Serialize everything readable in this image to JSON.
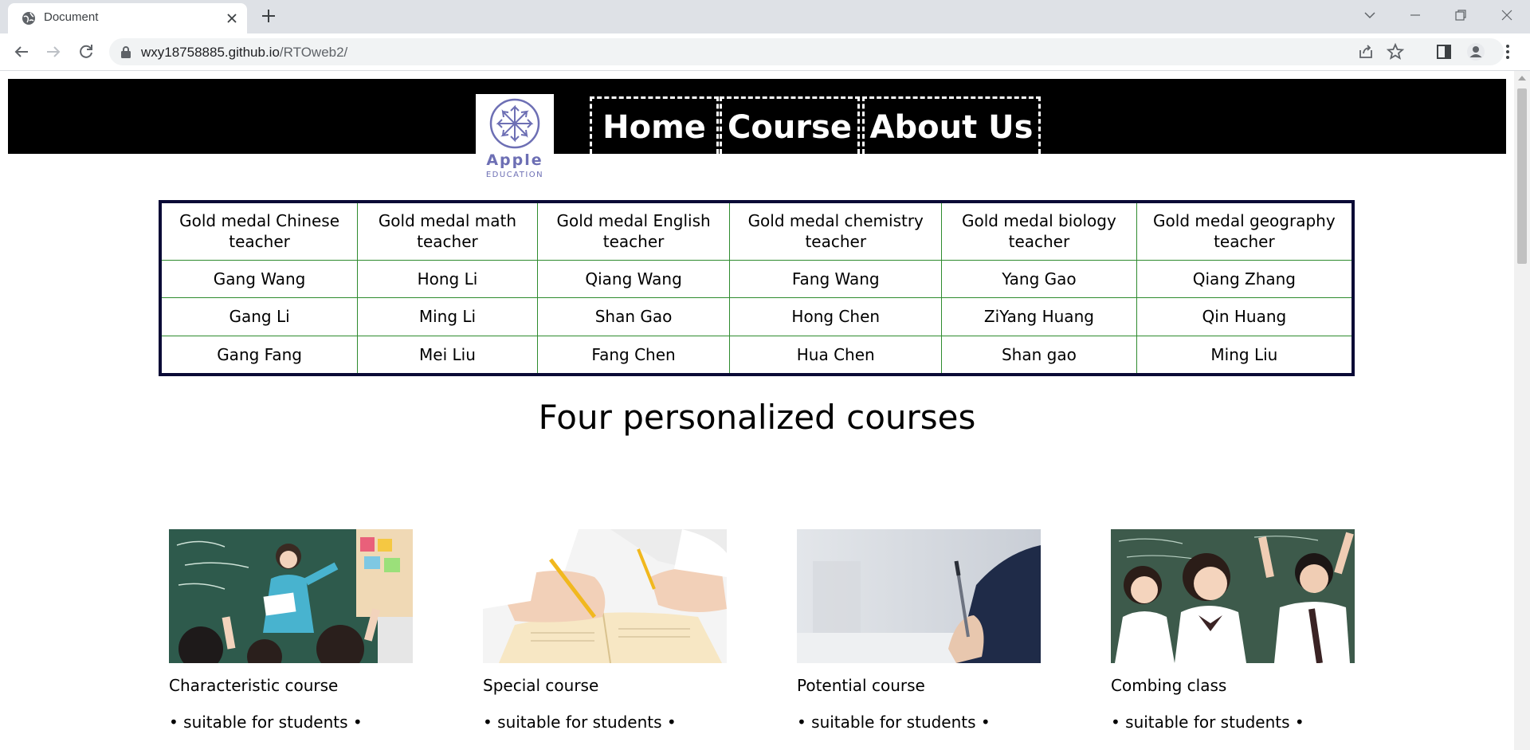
{
  "browser": {
    "tab_title": "Document",
    "url_host": "wxy18758885.github.io",
    "url_path": "/RTOweb2/"
  },
  "site": {
    "logo": {
      "brand": "Apple",
      "sub": "EDUCATION"
    },
    "nav": [
      {
        "label": "Home"
      },
      {
        "label": "Course"
      },
      {
        "label": "About Us"
      }
    ]
  },
  "teachers": {
    "headers": [
      "Gold medal Chinese teacher",
      "Gold medal math teacher",
      "Gold medal English teacher",
      "Gold medal chemistry teacher",
      "Gold medal biology teacher",
      "Gold medal geography teacher"
    ],
    "rows": [
      [
        "Gang Wang",
        "Hong Li",
        "Qiang Wang",
        "Fang Wang",
        "Yang Gao",
        "Qiang Zhang"
      ],
      [
        "Gang Li",
        "Ming Li",
        "Shan Gao",
        "Hong Chen",
        "ZiYang Huang",
        "Qin Huang"
      ],
      [
        "Gang Fang",
        "Mei Liu",
        "Fang Chen",
        "Hua Chen",
        "Shan gao",
        "Ming Liu"
      ]
    ]
  },
  "courses_heading": "Four personalized courses",
  "courses": [
    {
      "name": "Characteristic course",
      "desc": "• suitable for students •"
    },
    {
      "name": "Special course",
      "desc": "• suitable for students •"
    },
    {
      "name": "Potential course",
      "desc": "• suitable for students •"
    },
    {
      "name": "Combing class",
      "desc": "• suitable for students •"
    }
  ],
  "colors": {
    "header_bg": "#000000",
    "brand": "#6d6fb4",
    "table_border": "#0a0a36",
    "cell_border": "#2e8b2e"
  },
  "icons": [
    "globe-icon",
    "close-icon",
    "plus-icon",
    "back-icon",
    "forward-icon",
    "reload-icon",
    "lock-icon",
    "share-icon",
    "star-icon",
    "side-panel-icon",
    "profile-icon",
    "menu-icon"
  ]
}
